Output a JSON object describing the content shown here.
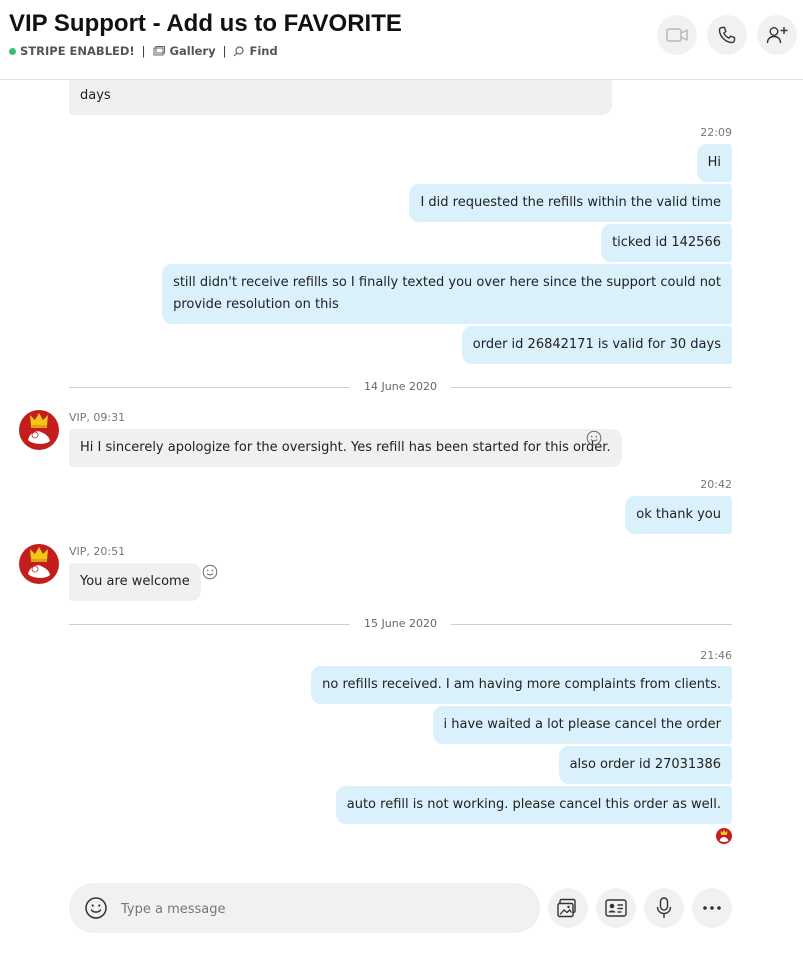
{
  "header": {
    "title": "VIP Support - Add us to FAVORITE",
    "status_label": "STRIPE ENABLED!",
    "gallery_label": "Gallery",
    "find_label": "Find",
    "separator": "|"
  },
  "messages": {
    "partial_top_text": "days",
    "time_2209": "22:09",
    "out_hi": "Hi",
    "out_requested": "I did requested the refills within the valid time",
    "out_ticked": "ticked id 142566",
    "out_still_line1": "still didn't receive refills so I finally texted you over here since the support could not",
    "out_still_line2": "provide resolution on this",
    "out_order_valid": "order id 26842171 is valid for 30 days",
    "date_14_june": "14 June 2020",
    "vip_meta_1": "VIP, 09:31",
    "in_apologize": "Hi I sincerely apologize for the oversight.  Yes refill has been started for this order.",
    "time_2042": "20:42",
    "out_ok": "ok thank you",
    "vip_meta_2": "VIP, 20:51",
    "in_welcome": "You are welcome",
    "date_15_june": "15 June 2020",
    "time_2146": "21:46",
    "out_no_refills": "no refills received. I am having more complaints from clients.",
    "out_waited": "i have waited a lot please cancel the order",
    "out_also_order": "also order id 27031386",
    "out_auto_refill": "auto refill is not working. please cancel this order as well."
  },
  "composer": {
    "placeholder": "Type a message"
  },
  "icons": {
    "video": "video-camera-icon",
    "call": "phone-icon",
    "add_person": "add-person-icon",
    "emoji": "smiley-icon",
    "media": "image-gallery-icon",
    "contact": "contact-card-icon",
    "mic": "microphone-icon",
    "more": "more-dots-icon"
  },
  "colors": {
    "outgoing_bubble": "#daf0fb",
    "incoming_bubble": "#f0f0f0",
    "online_dot": "#36c26b",
    "avatar_bg": "#c41d1d"
  }
}
